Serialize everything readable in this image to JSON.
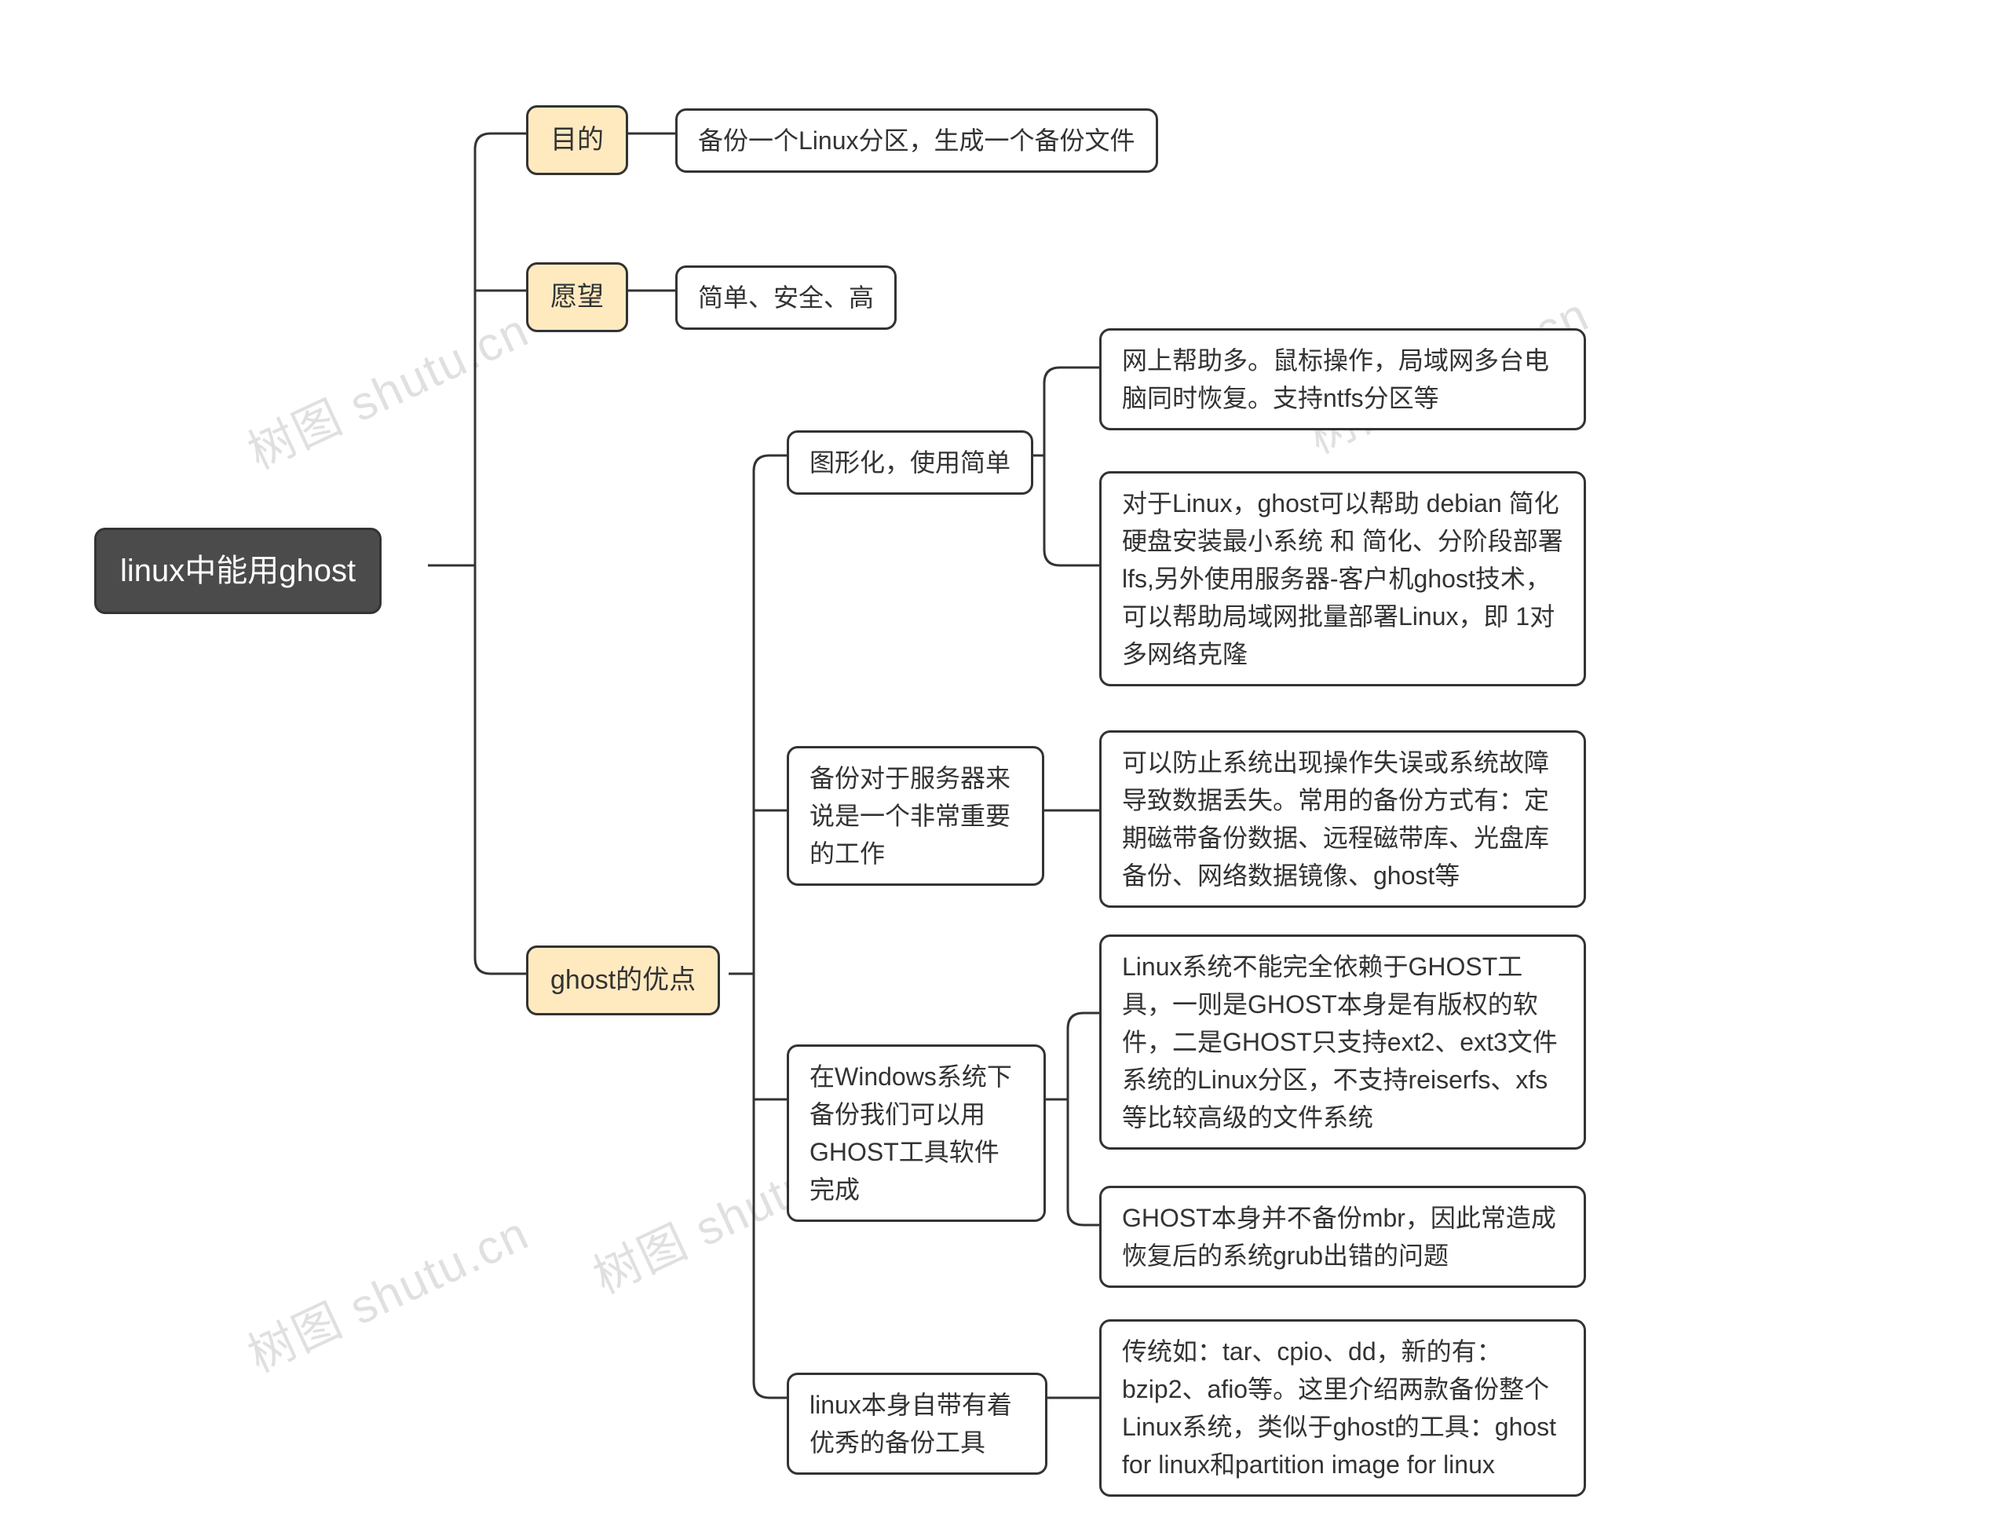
{
  "watermark": "树图 shutu.cn",
  "root": "linux中能用ghost",
  "b1": {
    "label": "目的",
    "leaf": "备份一个Linux分区，生成一个备份文件"
  },
  "b2": {
    "label": "愿望",
    "leaf": "简单、安全、高"
  },
  "b3": {
    "label": "ghost的优点",
    "c1": {
      "label": "图形化，使用简单",
      "l1": "网上帮助多。鼠标操作，局域网多台电脑同时恢复。支持ntfs分区等",
      "l2": "对于Linux，ghost可以帮助 debian 简化硬盘安装最小系统 和 简化、分阶段部署lfs,另外使用服务器-客户机ghost技术，可以帮助局域网批量部署Linux，即 1对多网络克隆"
    },
    "c2": {
      "label": "备份对于服务器来说是一个非常重要的工作",
      "l1": "可以防止系统出现操作失误或系统故障导致数据丢失。常用的备份方式有：定期磁带备份数据、远程磁带库、光盘库备份、网络数据镜像、ghost等"
    },
    "c3": {
      "label": "在Windows系统下备份我们可以用GHOST工具软件完成",
      "l1": "Linux系统不能完全依赖于GHOST工具，一则是GHOST本身是有版权的软件，二是GHOST只支持ext2、ext3文件系统的Linux分区，不支持reiserfs、xfs等比较高级的文件系统",
      "l2": "GHOST本身并不备份mbr，因此常造成恢复后的系统grub出错的问题"
    },
    "c4": {
      "label": "linux本身自带有着优秀的备份工具",
      "l1": "传统如：tar、cpio、dd，新的有：bzip2、afio等。这里介绍两款备份整个Linux系统，类似于ghost的工具：ghost for linux和partition image for linux"
    }
  }
}
